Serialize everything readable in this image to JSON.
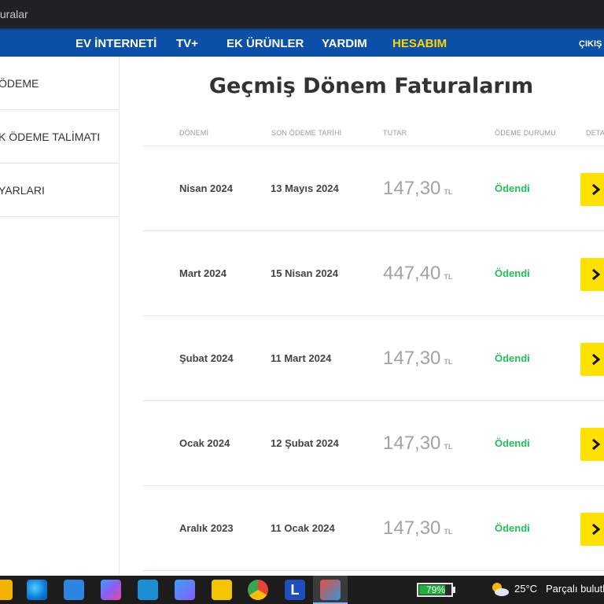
{
  "browser": {
    "tab_title": "turalar"
  },
  "nav": {
    "items": [
      {
        "label": "EV İNTERNETİ",
        "active": false
      },
      {
        "label": "TV+",
        "active": false
      },
      {
        "label": "EK ÜRÜNLER",
        "active": false
      },
      {
        "label": "YARDIM",
        "active": false
      },
      {
        "label": "HESABIM",
        "active": true
      }
    ],
    "logout": "ÇIKIŞ"
  },
  "sidebar": {
    "items": [
      {
        "label": "ÖDEME"
      },
      {
        "label": "K ÖDEME TALİMATI"
      },
      {
        "label": "YARLARI"
      }
    ]
  },
  "page": {
    "title": "Geçmiş Dönem Faturalarım"
  },
  "table": {
    "headers": {
      "period": "DÖNEMİ",
      "due": "SON ÖDEME TARİHİ",
      "amount": "TUTAR",
      "status": "ÖDEME DURUMU",
      "detail": "DETA"
    },
    "rows": [
      {
        "period": "Nisan 2024",
        "due": "13 Mayıs 2024",
        "amount": "147,30",
        "currency": "TL",
        "status": "Ödendi"
      },
      {
        "period": "Mart 2024",
        "due": "15 Nisan 2024",
        "amount": "447,40",
        "currency": "TL",
        "status": "Ödendi"
      },
      {
        "period": "Şubat 2024",
        "due": "11 Mart 2024",
        "amount": "147,30",
        "currency": "TL",
        "status": "Ödendi"
      },
      {
        "period": "Ocak 2024",
        "due": "12 Şubat 2024",
        "amount": "147,30",
        "currency": "TL",
        "status": "Ödendi"
      },
      {
        "period": "Aralık 2023",
        "due": "11 Ocak 2024",
        "amount": "147,30",
        "currency": "TL",
        "status": "Ödendi"
      }
    ]
  },
  "colors": {
    "nav_bg": "#0a4fa8",
    "nav_active": "#ffd400",
    "status_paid": "#21c05a",
    "detail_button": "#ffe100"
  },
  "taskbar": {
    "icons": [
      "file-explorer-icon",
      "edge-icon",
      "mail-icon",
      "copilot-icon",
      "laptop-icon",
      "copilot-2-icon",
      "sticky-notes-icon",
      "chrome-icon",
      "l-app-icon",
      "active-app-icon"
    ],
    "battery": {
      "percent": "79%",
      "level": 0.79
    },
    "weather": {
      "temp": "25°C",
      "desc": "Parçalı bulutl"
    }
  }
}
